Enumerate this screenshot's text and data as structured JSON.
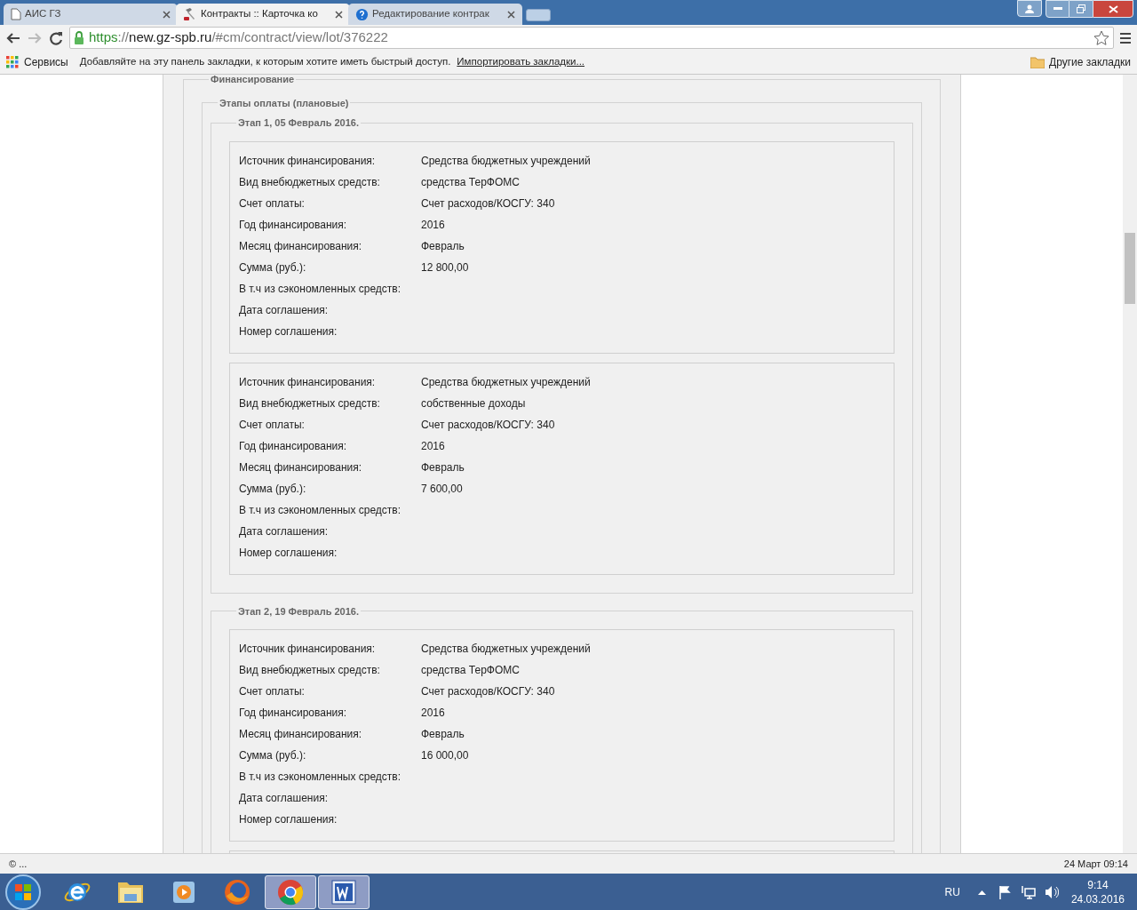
{
  "tabs": [
    {
      "title": "АИС ГЗ",
      "kind": "page",
      "selected": false
    },
    {
      "title": "Контракты :: Карточка ко",
      "kind": "tool",
      "selected": true
    },
    {
      "title": "Редактирование контрак",
      "kind": "help",
      "selected": false
    }
  ],
  "address": {
    "scheme": "https",
    "separator": "://",
    "host": "new.gz-spb.ru",
    "path": "/#cm/contract/view/lot/376222"
  },
  "bookmarks": {
    "apps": "Сервисы",
    "hint": "Добавляйте на эту панель закладки, к которым хотите иметь быстрый доступ.",
    "import_link": "Импортировать закладки...",
    "other": "Другие закладки"
  },
  "financing": {
    "legend": "Финансирование",
    "plan": {
      "legend": "Этапы оплаты (плановые)",
      "stages": [
        {
          "title": "Этап 1, 05 Февраль 2016.",
          "cards": [
            {
              "rows": [
                {
                  "label": "Источник финансирования:",
                  "value": "Средства бюджетных учреждений"
                },
                {
                  "label": "Вид внебюджетных средств:",
                  "value": "средства ТерФОМС"
                },
                {
                  "label": "Счет оплаты:",
                  "value": "Счет расходов/КОСГУ: 340"
                },
                {
                  "label": "Год финансирования:",
                  "value": "2016"
                },
                {
                  "label": "Месяц финансирования:",
                  "value": "Февраль"
                },
                {
                  "label": "Сумма (руб.):",
                  "value": "12 800,00"
                },
                {
                  "label": "В т.ч из сэкономленных средств:"
                },
                {
                  "label": "Дата соглашения:"
                },
                {
                  "label": "Номер соглашения:"
                }
              ]
            },
            {
              "rows": [
                {
                  "label": "Источник финансирования:",
                  "value": "Средства бюджетных учреждений"
                },
                {
                  "label": "Вид внебюджетных средств:",
                  "value": "собственные доходы"
                },
                {
                  "label": "Счет оплаты:",
                  "value": "Счет расходов/КОСГУ: 340"
                },
                {
                  "label": "Год финансирования:",
                  "value": "2016"
                },
                {
                  "label": "Месяц финансирования:",
                  "value": "Февраль"
                },
                {
                  "label": "Сумма (руб.):",
                  "value": "7 600,00"
                },
                {
                  "label": "В т.ч из сэкономленных средств:"
                },
                {
                  "label": "Дата соглашения:"
                },
                {
                  "label": "Номер соглашения:"
                }
              ]
            }
          ]
        },
        {
          "title": "Этап 2, 19 Февраль 2016.",
          "cards": [
            {
              "rows": [
                {
                  "label": "Источник финансирования:",
                  "value": "Средства бюджетных учреждений"
                },
                {
                  "label": "Вид внебюджетных средств:",
                  "value": "средства ТерФОМС"
                },
                {
                  "label": "Счет оплаты:",
                  "value": "Счет расходов/КОСГУ: 340"
                },
                {
                  "label": "Год финансирования:",
                  "value": "2016"
                },
                {
                  "label": "Месяц финансирования:",
                  "value": "Февраль"
                },
                {
                  "label": "Сумма (руб.):",
                  "value": "16 000,00"
                },
                {
                  "label": "В т.ч из сэкономленных средств:"
                },
                {
                  "label": "Дата соглашения:"
                },
                {
                  "label": "Номер соглашения:"
                }
              ]
            }
          ]
        }
      ]
    }
  },
  "status_bar": {
    "left": "© ...",
    "right": "24 Март 09:14"
  },
  "taskbar": {
    "apps": [
      {
        "kind": "ie",
        "running": false
      },
      {
        "kind": "folder",
        "running": false
      },
      {
        "kind": "media",
        "running": false
      },
      {
        "kind": "firefox",
        "running": false
      },
      {
        "kind": "chrome",
        "running": true
      },
      {
        "kind": "word",
        "running": true
      }
    ],
    "language": "RU",
    "time": "9:14",
    "date": "24.03.2016"
  }
}
